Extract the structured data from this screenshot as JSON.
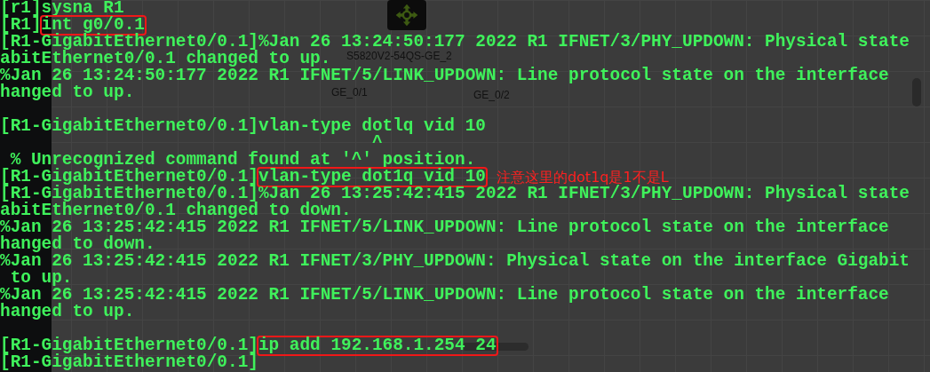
{
  "diagram": {
    "nodes": [
      {
        "kind": "switch",
        "label": "S5820V2-54QS-GE_2"
      }
    ],
    "labels": [
      {
        "text": "GE_0/1"
      },
      {
        "text": "GE_0/2"
      }
    ]
  },
  "terminal": {
    "lines": [
      {
        "kind": "text",
        "text": "[r1]sysna R1"
      },
      {
        "kind": "segments",
        "segments": [
          {
            "text": "[R1]",
            "boxed": false
          },
          {
            "text": "int g0/0.1",
            "boxed": true
          }
        ]
      },
      {
        "kind": "text",
        "text": "[R1-GigabitEthernet0/0.1]%Jan 26 13:24:50:177 2022 R1 IFNET/3/PHY_UPDOWN: Physical state"
      },
      {
        "kind": "text",
        "text": "abitEthernet0/0.1 changed to up."
      },
      {
        "kind": "text",
        "text": "%Jan 26 13:24:50:177 2022 R1 IFNET/5/LINK_UPDOWN: Line protocol state on the interface"
      },
      {
        "kind": "text",
        "text": "hanged to up."
      },
      {
        "kind": "blank"
      },
      {
        "kind": "text",
        "text": "[R1-GigabitEthernet0/0.1]vlan-type dotlq vid 10"
      },
      {
        "kind": "text",
        "text": "                                    ^"
      },
      {
        "kind": "text",
        "text": " % Unrecognized command found at '^' position."
      },
      {
        "kind": "segments",
        "segments": [
          {
            "text": "[R1-GigabitEthernet0/0.1]",
            "boxed": false
          },
          {
            "text": "vlan-type dot1q vid 10",
            "boxed": true
          }
        ],
        "note": "注意这里的dot1q是1不是L"
      },
      {
        "kind": "text",
        "text": "[R1-GigabitEthernet0/0.1]%Jan 26 13:25:42:415 2022 R1 IFNET/3/PHY_UPDOWN: Physical state"
      },
      {
        "kind": "text",
        "text": "abitEthernet0/0.1 changed to down."
      },
      {
        "kind": "text",
        "text": "%Jan 26 13:25:42:415 2022 R1 IFNET/5/LINK_UPDOWN: Line protocol state on the interface"
      },
      {
        "kind": "text",
        "text": "hanged to down."
      },
      {
        "kind": "text",
        "text": "%Jan 26 13:25:42:415 2022 R1 IFNET/3/PHY_UPDOWN: Physical state on the interface Gigabit"
      },
      {
        "kind": "text",
        "text": " to up."
      },
      {
        "kind": "text",
        "text": "%Jan 26 13:25:42:415 2022 R1 IFNET/5/LINK_UPDOWN: Line protocol state on the interface"
      },
      {
        "kind": "text",
        "text": "hanged to up."
      },
      {
        "kind": "blank"
      },
      {
        "kind": "segments",
        "segments": [
          {
            "text": "[R1-GigabitEthernet0/0.1]",
            "boxed": false
          },
          {
            "text": "ip add 192.168.1.254 24",
            "boxed": true
          }
        ]
      },
      {
        "kind": "text",
        "text": "[R1-GigabitEthernet0/0.1]"
      }
    ]
  }
}
